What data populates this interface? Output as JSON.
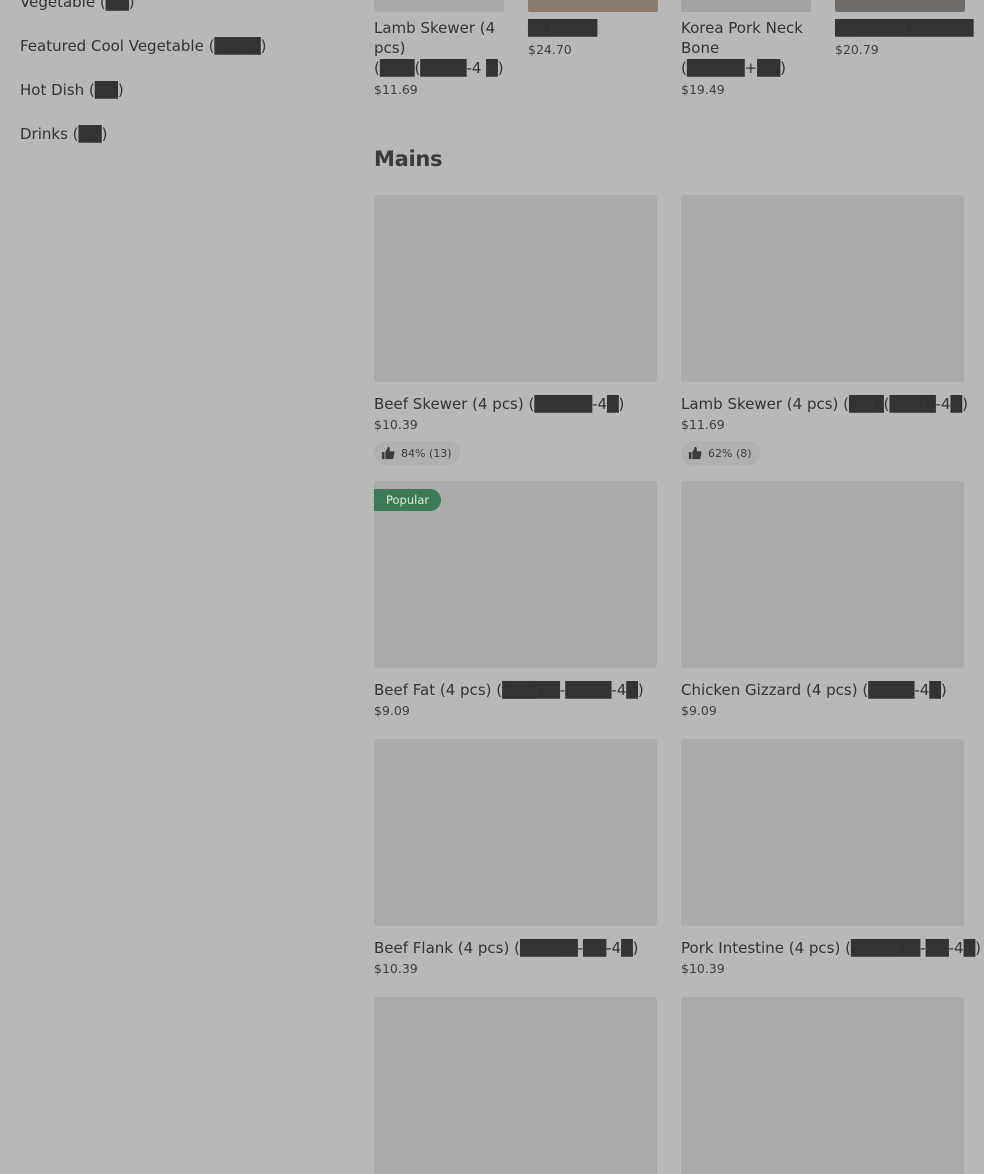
{
  "sidebar": {
    "items": [
      {
        "label": "Vegetable (██)"
      },
      {
        "label": "Featured Cool Vegetable (████)"
      },
      {
        "label": "Hot Dish (██)"
      },
      {
        "label": "Drinks (██)"
      }
    ]
  },
  "carousel": {
    "items": [
      {
        "name": "Lamb Skewer (4 pcs) (███(████-4 █)",
        "price": "$11.69"
      },
      {
        "name": "██████",
        "price": "$24.70"
      },
      {
        "name": "Korea Pork Neck Bone (█████+██)",
        "price": "$19.49"
      },
      {
        "name": "████████████",
        "price": "$20.79"
      }
    ]
  },
  "mains": {
    "title": "Mains",
    "items": [
      {
        "name": "Beef Skewer (4 pcs) (█████-4█)",
        "price": "$10.39",
        "rating": "84% (13)"
      },
      {
        "name": "Lamb Skewer (4 pcs) (███(████-4█)",
        "price": "$11.69",
        "rating": "62% (8)"
      },
      {
        "name": "Beef Fat (4 pcs) (█████-████-4█)",
        "price": "$9.09",
        "badge": "Popular"
      },
      {
        "name": "Chicken Gizzard (4 pcs) (████-4█)",
        "price": "$9.09"
      },
      {
        "name": "Beef Flank (4 pcs) (█████-██-4█)",
        "price": "$10.39"
      },
      {
        "name": "Pork Intestine (4 pcs) (██████-██-4█)",
        "price": "$10.39"
      }
    ]
  },
  "icons": {
    "thumb": "thumbs-up-icon"
  }
}
